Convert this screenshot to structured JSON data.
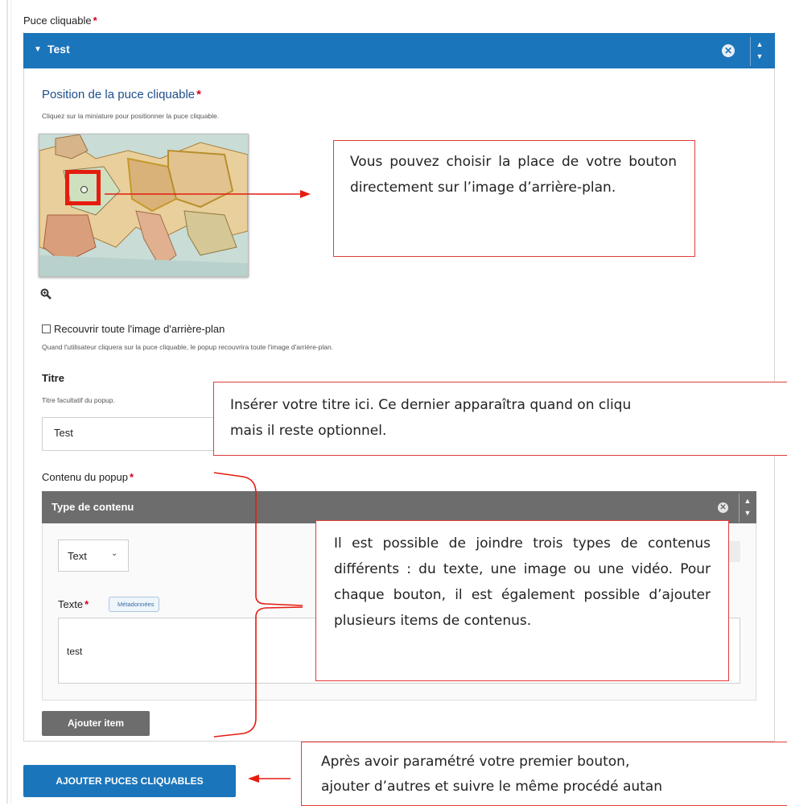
{
  "form": {
    "puce_label": "Puce cliquable",
    "required_mark": "*",
    "panel_title": "Test",
    "position_title": "Position de la puce cliquable",
    "position_hint": "Cliquez sur la miniature pour positionner la puce cliquable.",
    "cover_checkbox_label": "Recouvrir toute l'image d'arrière-plan",
    "cover_checkbox_checked": false,
    "cover_hint": "Quand l'utilisateur cliquera sur la puce cliquable, le popup recouvrira toute l'image d'arrière-plan.",
    "titre_label": "Titre",
    "titre_hint": "Titre facultatif du popup.",
    "titre_value": "Test",
    "contenu_label": "Contenu du popup",
    "type_contenu_title": "Type de contenu",
    "type_select_value": "Text",
    "texte_label": "Texte",
    "meta_tag": "Métadonnées",
    "texte_value": "test",
    "add_item_button": "Ajouter item",
    "add_puces_button": "AJOUTER PUCES CLIQUABLES"
  },
  "icons": {
    "collapse": "triangle-down",
    "close": "x-circle",
    "sort": "up-down-arrows",
    "zoom": "magnifier-plus",
    "select_chevron": "chevron-down"
  },
  "callouts": {
    "position": "Vous pouvez choisir la place de votre bouton directement sur l’image d’arrière-plan.",
    "title_line1": "Insérer votre titre ici. Ce dernier apparaîtra quand on cliqu",
    "title_line2": "mais il reste optionnel.",
    "content": "Il est possible de joindre trois types de contenus différents : du texte, une image ou une vidéo. Pour chaque bouton, il est également possible d’ajouter plusieurs items de contenus.",
    "add_line1": "Après avoir paramétré votre premier bouton,",
    "add_line2": "ajouter d’autres et suivre le même procédé autan"
  },
  "colors": {
    "primary_blue": "#1b75bb",
    "header_gray": "#6d6d6d",
    "annotation_red": "#e51c10",
    "required_red": "#d0021b"
  }
}
